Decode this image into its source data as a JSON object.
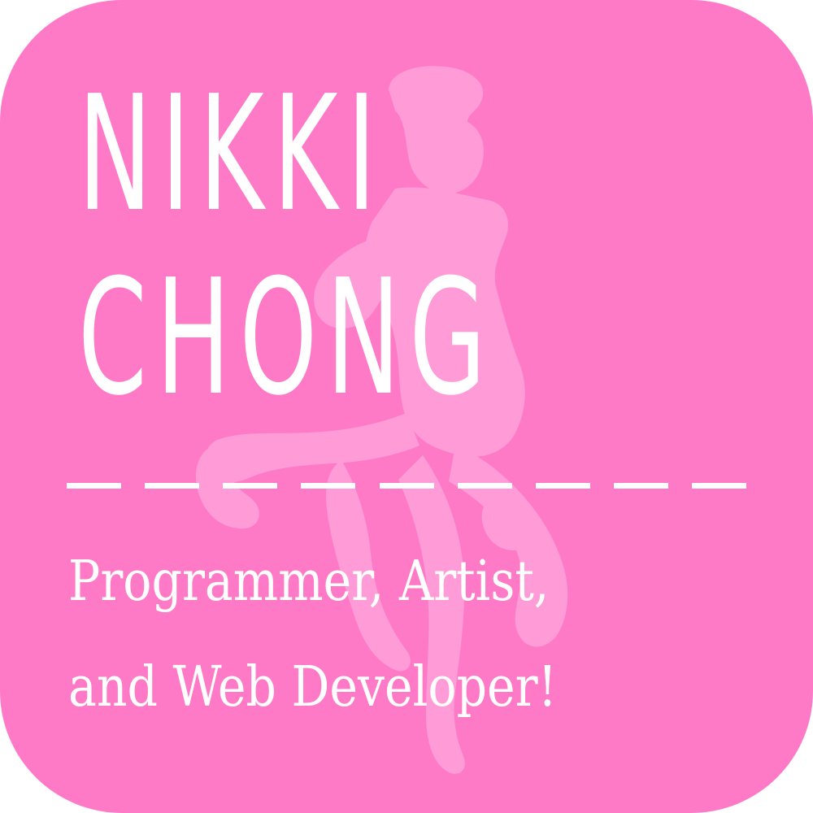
{
  "colors": {
    "background": "#ff7ac6",
    "silhouette": "#ff9bd6",
    "text": "#ffffff"
  },
  "name": {
    "line1": "NIKKI",
    "line2": "CHONG"
  },
  "divider": {
    "dash_count": 9
  },
  "tagline": {
    "line1": "Programmer, Artist,",
    "line2": "and Web Developer!"
  }
}
